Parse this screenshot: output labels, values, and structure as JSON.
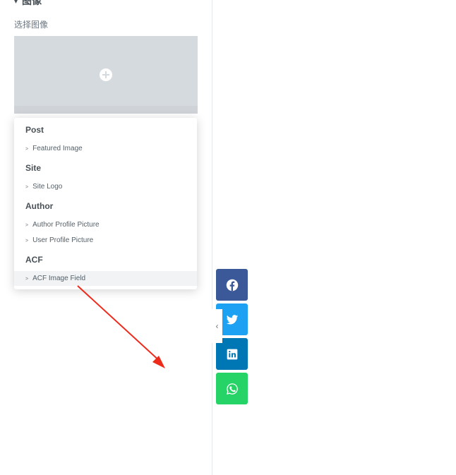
{
  "panel": {
    "section_title": "图像",
    "image_control_label": "选择图像"
  },
  "dynamic_tags": {
    "groups": [
      {
        "title": "Post",
        "items": [
          {
            "label": "Featured Image"
          }
        ]
      },
      {
        "title": "Site",
        "items": [
          {
            "label": "Site Logo"
          }
        ]
      },
      {
        "title": "Author",
        "items": [
          {
            "label": "Author Profile Picture"
          },
          {
            "label": "User Profile Picture"
          }
        ]
      },
      {
        "title": "ACF",
        "items": [
          {
            "label": "ACF Image Field"
          }
        ]
      }
    ],
    "highlighted_item": "ACF Image Field"
  },
  "share_buttons": [
    {
      "network": "facebook",
      "icon": "facebook-icon",
      "color": "#3b5998"
    },
    {
      "network": "twitter",
      "icon": "twitter-icon",
      "color": "#1da1f2"
    },
    {
      "network": "linkedin",
      "icon": "linkedin-icon",
      "color": "#0077b5"
    },
    {
      "network": "whatsapp",
      "icon": "whatsapp-icon",
      "color": "#25d366"
    }
  ],
  "colors": {
    "annotation_arrow": "#ee2a1b",
    "panel_background": "#ffffff",
    "placeholder": "#d5dadf"
  }
}
